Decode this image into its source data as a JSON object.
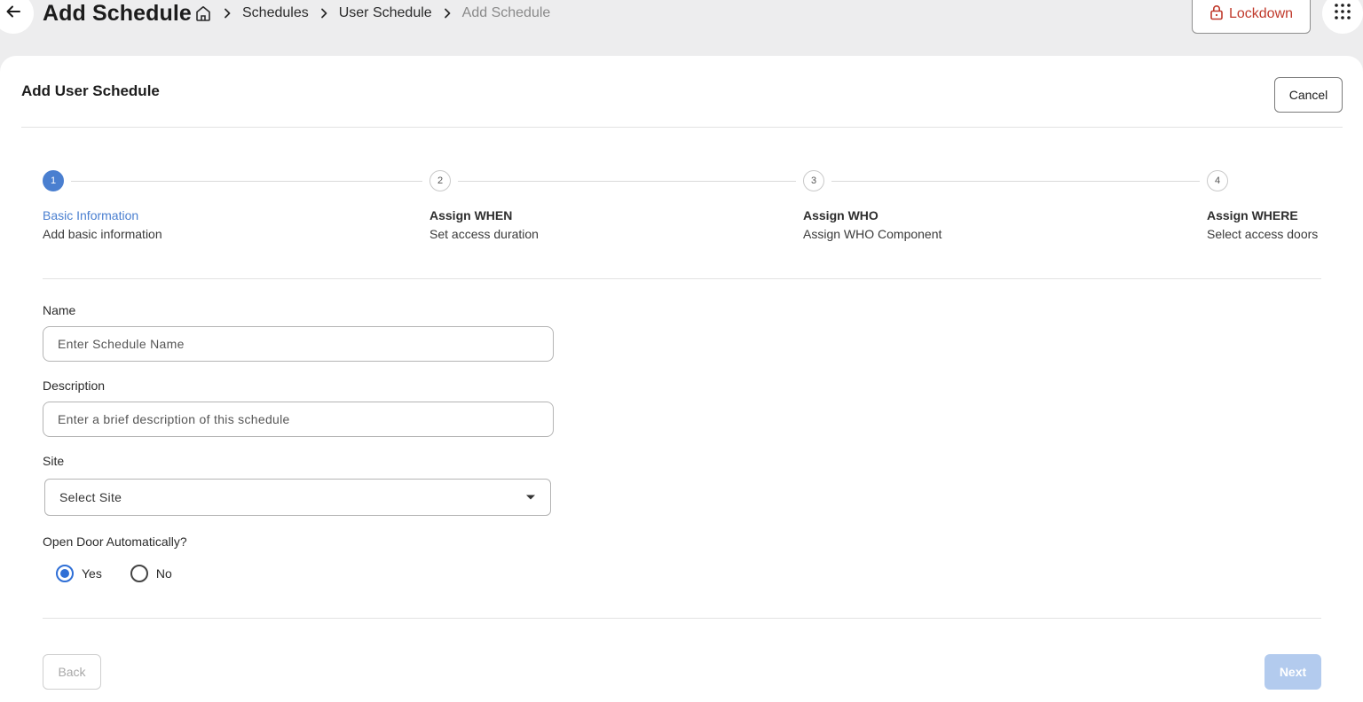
{
  "header": {
    "title": "Add Schedule",
    "breadcrumbs": [
      "Schedules",
      "User Schedule",
      "Add Schedule"
    ],
    "lockdown_label": "Lockdown",
    "lockdown_color": "#c0392b"
  },
  "card": {
    "title": "Add User Schedule",
    "cancel_label": "Cancel"
  },
  "stepper": {
    "active_step": 1,
    "steps": [
      {
        "number": "1",
        "title": "Basic Information",
        "subtitle": "Add basic information"
      },
      {
        "number": "2",
        "title": "Assign WHEN",
        "subtitle": "Set access duration"
      },
      {
        "number": "3",
        "title": "Assign WHO",
        "subtitle": "Assign WHO Component"
      },
      {
        "number": "4",
        "title": "Assign WHERE",
        "subtitle": "Select access doors"
      }
    ],
    "active_color": "#4a7fd0"
  },
  "form": {
    "name": {
      "label": "Name",
      "value": "",
      "placeholder": "Enter Schedule Name"
    },
    "description": {
      "label": "Description",
      "value": "",
      "placeholder": "Enter a brief description of this schedule"
    },
    "site": {
      "label": "Site",
      "value": "Select Site"
    },
    "open_door": {
      "label": "Open Door Automatically?",
      "options": [
        "Yes",
        "No"
      ],
      "selected": "Yes"
    }
  },
  "footer": {
    "back_label": "Back",
    "next_label": "Next"
  },
  "icons": [
    "arrow-left-icon",
    "home-icon",
    "chevron-right-icon",
    "lock-icon",
    "grid-apps-icon",
    "caret-down-icon"
  ]
}
